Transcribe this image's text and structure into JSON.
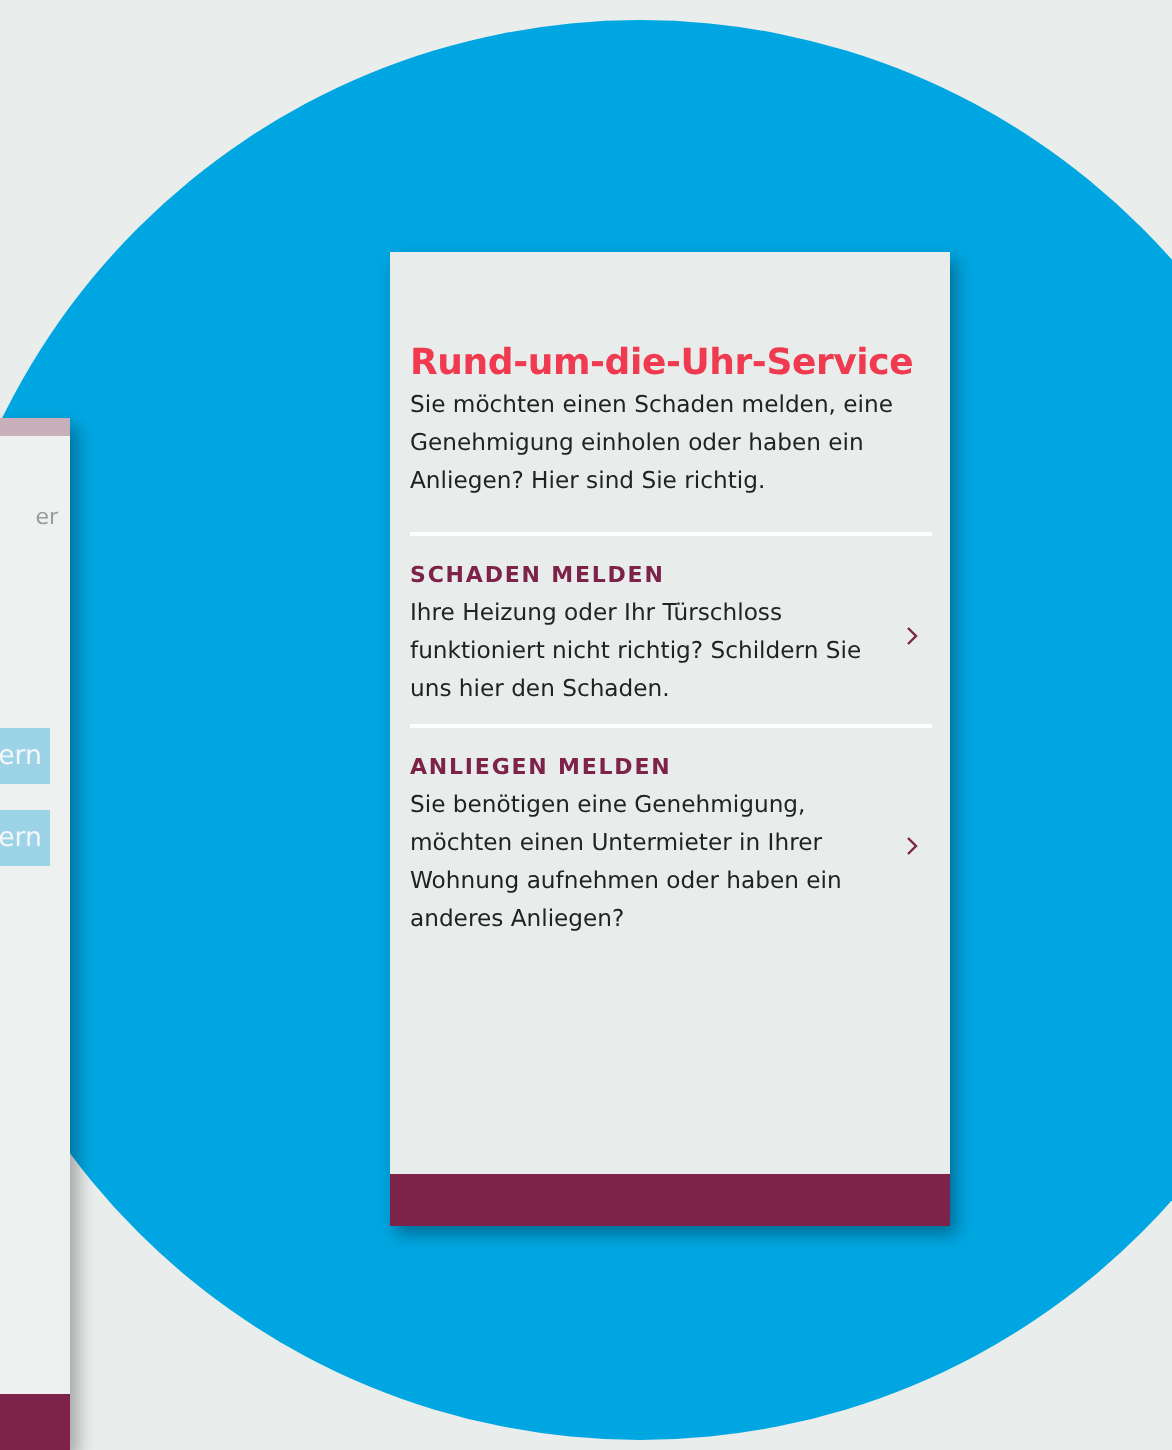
{
  "back_card": {
    "label": "er",
    "buttons": [
      {
        "label": "ern"
      },
      {
        "label": "ern"
      }
    ]
  },
  "service_card": {
    "title": "Rund-um-die-Uhr-Service",
    "intro": "Sie möchten einen Schaden melden, eine Genehmigung einholen oder haben ein Anliegen? Hier sind Sie richtig.",
    "items": [
      {
        "heading": "SCHADEN MELDEN",
        "text": "Ihre Heizung oder Ihr Türschloss funktioniert nicht richtig? Schildern Sie uns hier den Schaden."
      },
      {
        "heading": "ANLIEGEN MELDEN",
        "text": "Sie benötigen eine Genehmigung, möchten einen Untermieter in Ihrer Wohnung aufnehmen oder haben ein anderes Anliegen?"
      }
    ]
  }
}
